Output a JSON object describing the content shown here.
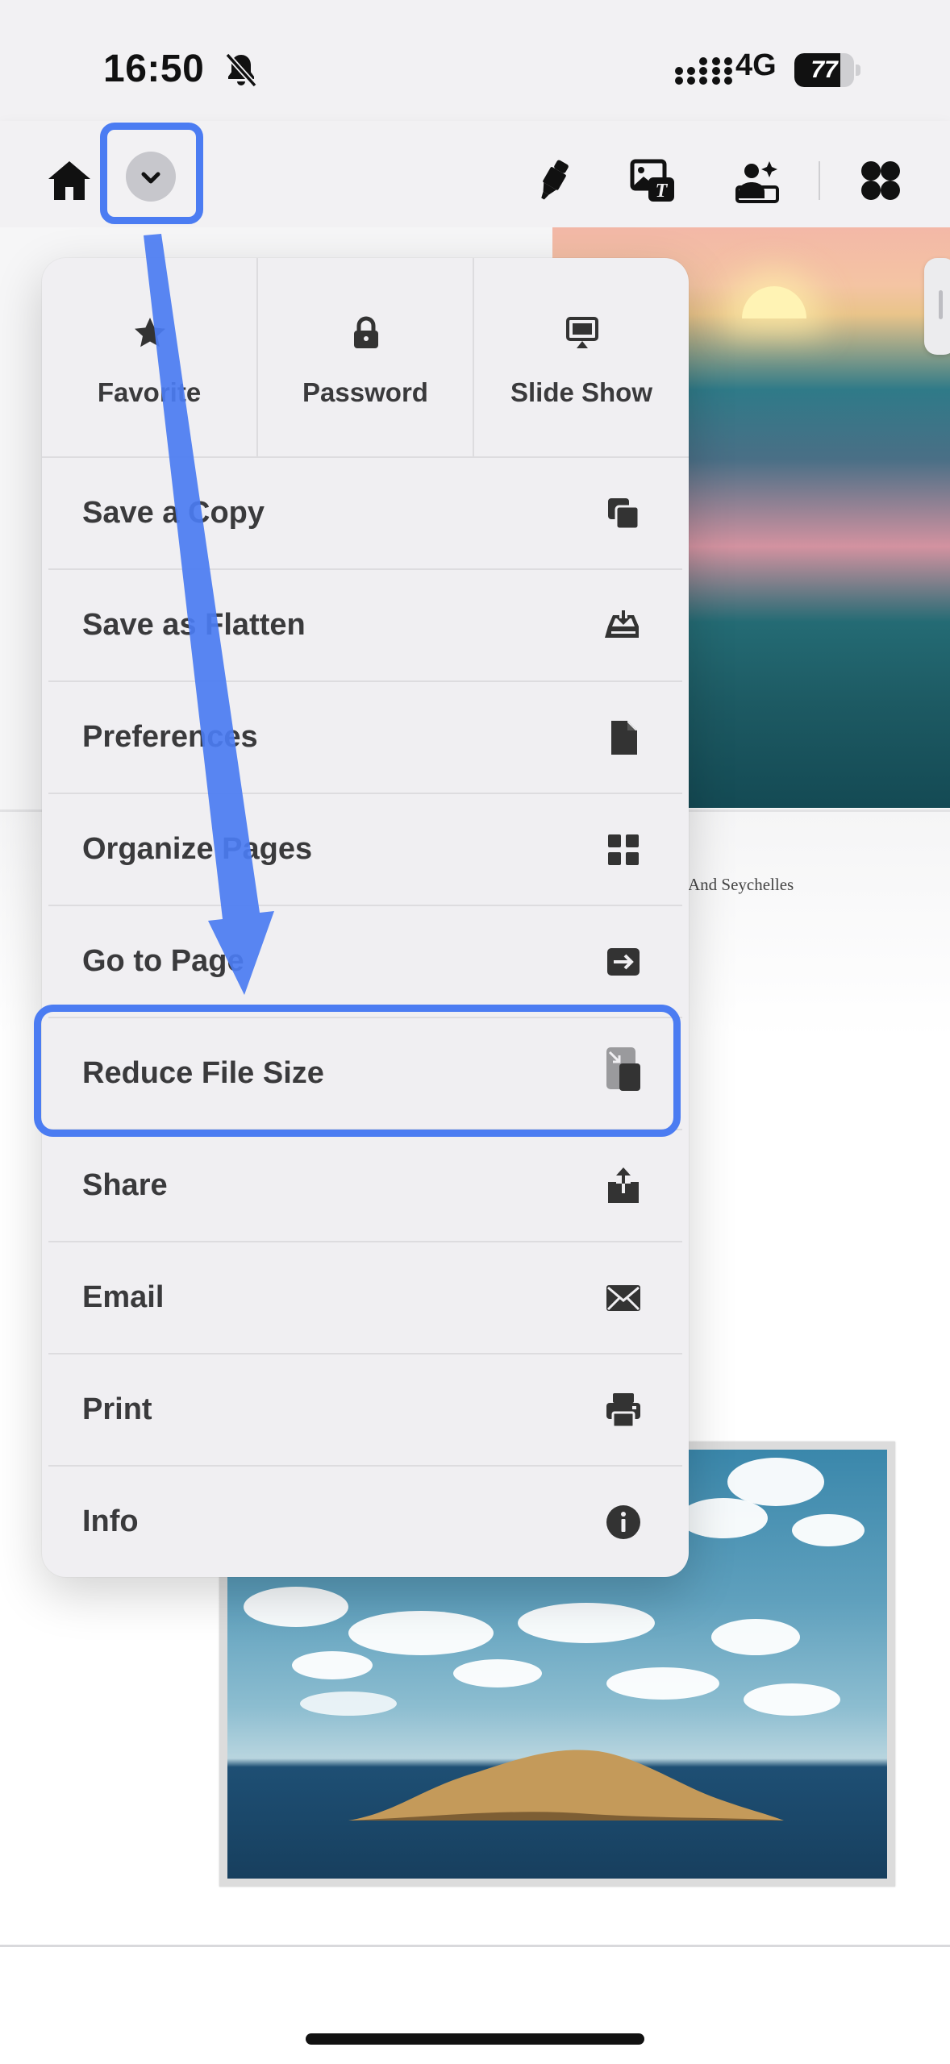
{
  "status_bar": {
    "time": "16:50",
    "network": "4G",
    "battery": "77",
    "battery_level_percent": 77
  },
  "toolbar": {
    "icons": [
      "home-icon",
      "chevron-down-icon",
      "highlighter-icon",
      "image-text-icon",
      "ai-photo-icon",
      "apps-icon"
    ]
  },
  "document": {
    "caption_fragment": "And  Seychelles"
  },
  "menu": {
    "top_buttons": [
      {
        "label": "Favorite",
        "icon": "star-icon"
      },
      {
        "label": "Password",
        "icon": "lock-icon"
      },
      {
        "label": "Slide Show",
        "icon": "slideshow-icon"
      }
    ],
    "items": [
      {
        "label": "Save a Copy",
        "icon": "copy-icon"
      },
      {
        "label": "Save as Flatten",
        "icon": "tray-download-icon"
      },
      {
        "label": "Preferences",
        "icon": "document-icon"
      },
      {
        "label": "Organize Pages",
        "icon": "grid-icon"
      },
      {
        "label": "Go to Page",
        "icon": "arrow-right-box-icon"
      },
      {
        "label": "Reduce File Size",
        "icon": "compress-file-icon"
      },
      {
        "label": "Share",
        "icon": "share-icon"
      },
      {
        "label": "Email",
        "icon": "envelope-icon"
      },
      {
        "label": "Print",
        "icon": "printer-icon"
      },
      {
        "label": "Info",
        "icon": "info-icon"
      }
    ]
  },
  "colors": {
    "annotation_blue": "#4b7cf2",
    "menu_background": "#f0eff2",
    "text": "#3a3a3c"
  }
}
